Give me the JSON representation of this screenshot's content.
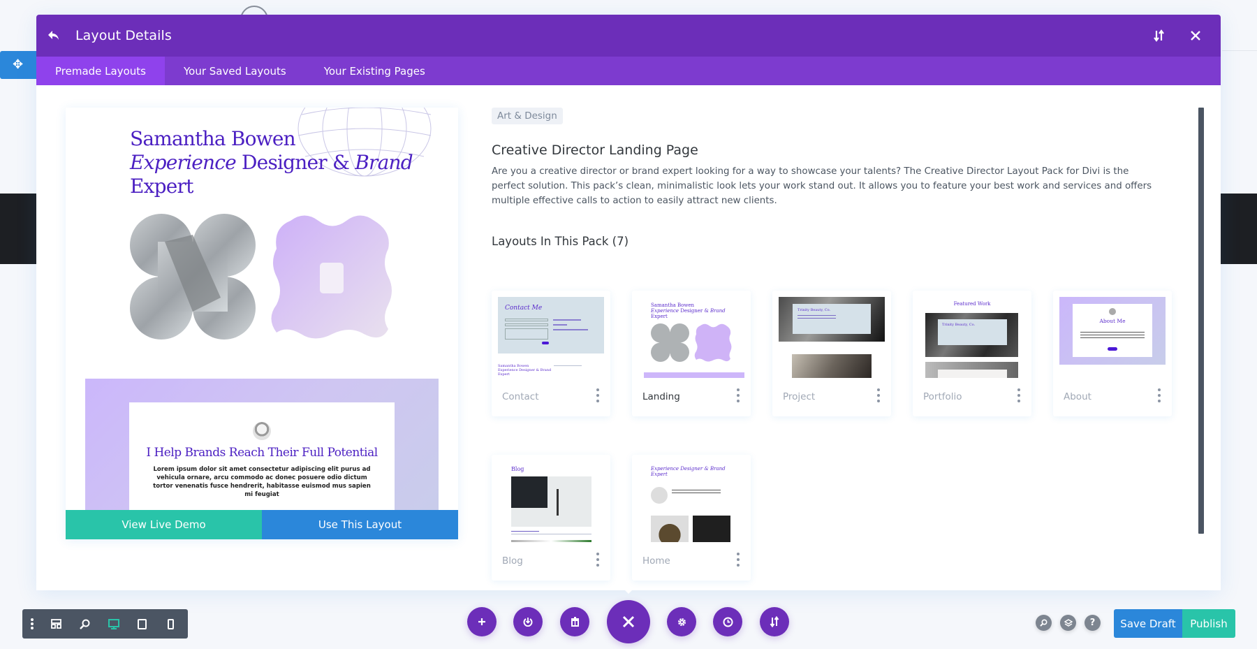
{
  "modal": {
    "title": "Layout Details",
    "back_icon": "undo-arrow-icon",
    "header_actions": [
      {
        "name": "toggle-sort",
        "icon": "arrows-up-down-icon"
      },
      {
        "name": "close",
        "icon": "close-icon"
      }
    ],
    "tabs": [
      {
        "label": "Premade Layouts",
        "active": true
      },
      {
        "label": "Your Saved Layouts",
        "active": false
      },
      {
        "label": "Your Existing Pages",
        "active": false
      }
    ]
  },
  "preview": {
    "hero_name": "Samantha Bowen",
    "hero_line_italic1": "Experience",
    "hero_line_mid": " Designer & ",
    "hero_line_italic2": "Brand",
    "hero_line3": "Expert",
    "section_title": "I Help Brands Reach Their Full Potential",
    "section_body": "Lorem ipsum dolor sit amet consectetur adipiscing elit purus ad vehicula ornare, arcu commodo ac donec posuere odio dictum tortor venenatis fusce hendrerit, habitasse euismod mus sapien mi feugiat",
    "view_demo_label": "View Live Demo",
    "use_layout_label": "Use This Layout"
  },
  "details": {
    "category": "Art & Design",
    "title": "Creative Director Landing Page",
    "description": "Are you a creative director or brand expert looking for a way to showcase your talents? The Creative Director Layout Pack for Divi is the perfect solution. This pack’s clean, minimalistic look lets your work stand out. It allows you to feature your best work and services and offers multiple effective calls to action to easily attract new clients.",
    "pack_heading": "Layouts In This Pack (7)"
  },
  "layouts": [
    {
      "name": "Contact",
      "active": false,
      "thumb_title": "Contact Me"
    },
    {
      "name": "Landing",
      "active": true,
      "thumb_title": "Samantha Bowen"
    },
    {
      "name": "Project",
      "active": false,
      "thumb_title": "Trinity Beauty, Co."
    },
    {
      "name": "Portfolio",
      "active": false,
      "thumb_title": "Featured Work"
    },
    {
      "name": "About",
      "active": false,
      "thumb_title": "About Me"
    },
    {
      "name": "Blog",
      "active": false,
      "thumb_title": "Blog"
    },
    {
      "name": "Home",
      "active": false,
      "thumb_title": "Experience Designer & Brand Expert"
    }
  ],
  "bottom_bar": {
    "left_tools": [
      {
        "name": "more",
        "icon": "vertical-dots-icon"
      },
      {
        "name": "wireframe",
        "icon": "layout-grid-icon"
      },
      {
        "name": "zoom",
        "icon": "zoom-icon"
      },
      {
        "name": "desktop",
        "icon": "desktop-icon",
        "active": true
      },
      {
        "name": "tablet",
        "icon": "tablet-icon"
      },
      {
        "name": "phone",
        "icon": "phone-icon"
      }
    ],
    "center_tools": [
      {
        "name": "add",
        "icon": "plus-icon"
      },
      {
        "name": "save-to-library",
        "icon": "power-download-icon"
      },
      {
        "name": "clear",
        "icon": "trash-icon"
      },
      {
        "name": "close-settings",
        "icon": "close-icon"
      },
      {
        "name": "page-settings",
        "icon": "gear-icon"
      },
      {
        "name": "history",
        "icon": "clock-icon"
      },
      {
        "name": "portability",
        "icon": "arrows-up-down-icon"
      }
    ],
    "right_icons": [
      {
        "name": "search",
        "icon": "search-icon"
      },
      {
        "name": "layers",
        "icon": "layers-icon"
      },
      {
        "name": "help",
        "icon": "help-icon",
        "text": "?"
      }
    ],
    "save_draft_label": "Save Draft",
    "publish_label": "Publish"
  },
  "colors": {
    "header": "#6c2eb9",
    "tabs": "#7d3bcf",
    "tab_active": "#8f42ec",
    "teal": "#29c4a9",
    "blue": "#2b87da",
    "dark_gray": "#4b5563"
  }
}
